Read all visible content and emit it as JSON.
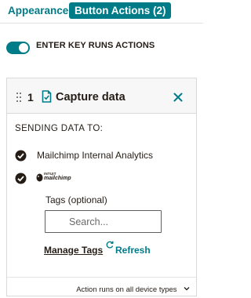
{
  "tabs": [
    {
      "label": "Appearance"
    },
    {
      "label": "Button Actions (2)"
    }
  ],
  "toggle": {
    "label": "ENTER KEY RUNS ACTIONS",
    "on": true
  },
  "card": {
    "step_number": "1",
    "title": "Capture data",
    "sending_label": "SENDING DATA TO:",
    "destinations": [
      {
        "label": "Mailchimp Internal Analytics",
        "checked": true
      },
      {
        "logo_text_top": "INTUIT",
        "logo_text_main": "mailchimp",
        "checked": true
      }
    ],
    "tags": {
      "label": "Tags (optional)",
      "placeholder": "Search...",
      "manage_label": "Manage Tags",
      "refresh_label": "Refresh"
    },
    "footer": {
      "device_label": "Action runs on all device types"
    }
  },
  "colors": {
    "accent": "#007c89",
    "text": "#241c15"
  }
}
